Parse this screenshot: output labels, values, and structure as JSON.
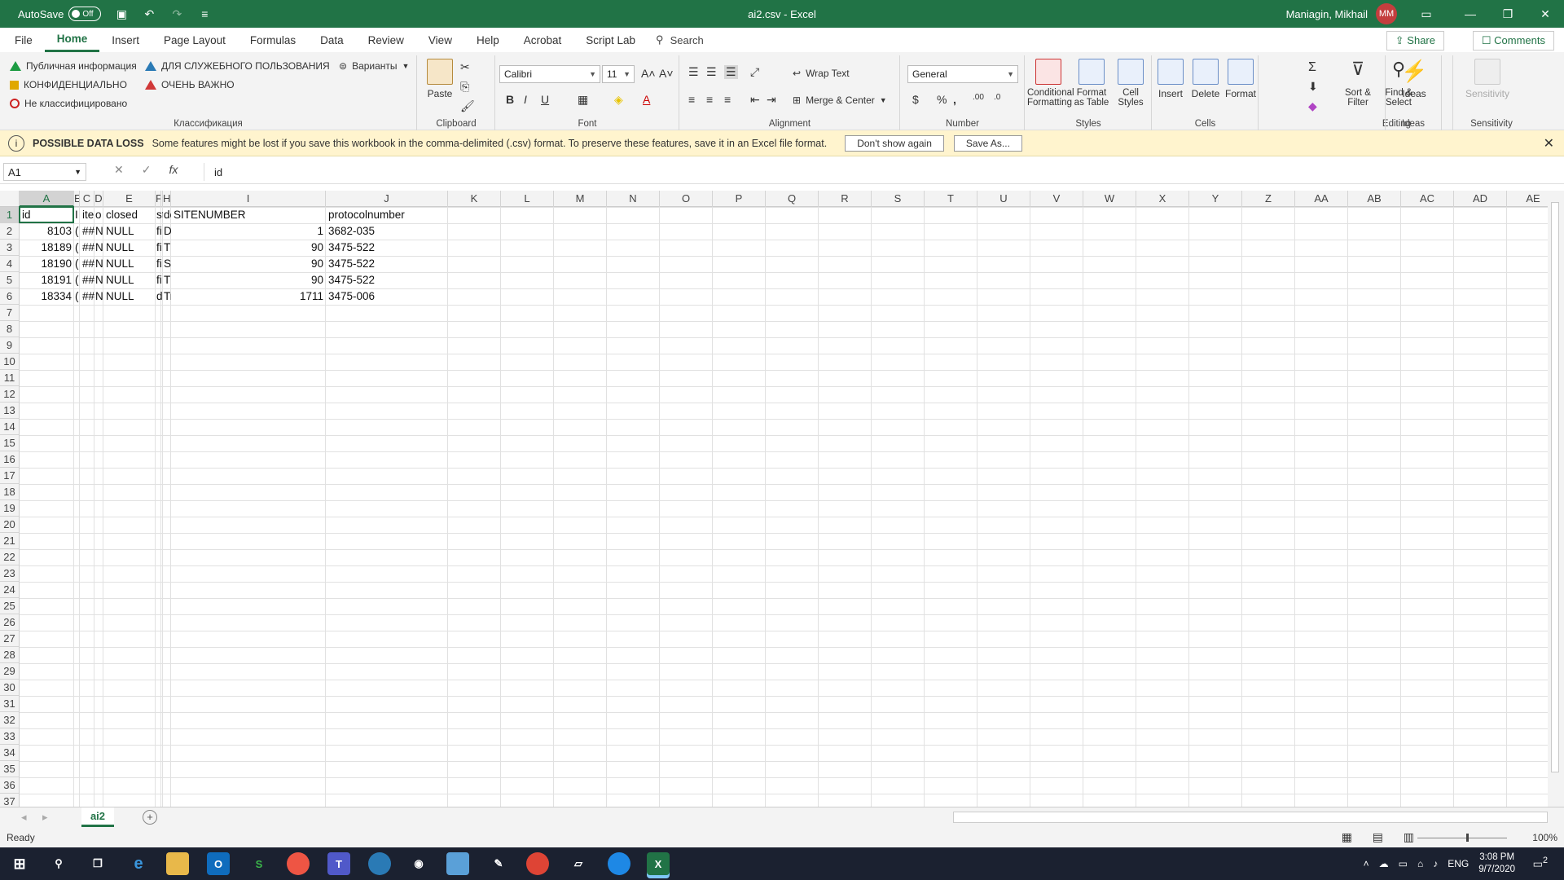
{
  "titlebar": {
    "autosave_label": "AutoSave",
    "autosave_state": "Off",
    "window_title": "ai2.csv  -  Excel",
    "user_name": "Maniagin, Mikhail",
    "user_initials": "MM"
  },
  "tabs": [
    "File",
    "Home",
    "Insert",
    "Page Layout",
    "Formulas",
    "Data",
    "Review",
    "View",
    "Help",
    "Acrobat",
    "Script Lab"
  ],
  "active_tab": "Home",
  "search_label": "Search",
  "share_label": "Share",
  "comments_label": "Comments",
  "ribbon": {
    "classification": {
      "items": [
        "Публичная информация",
        "КОНФИДЕНЦИАЛЬНО",
        "Не классифицировано",
        "ДЛЯ СЛУЖЕБНОГО ПОЛЬЗОВАНИЯ",
        "ОЧЕНЬ ВАЖНО"
      ],
      "variants_label": "Варианты",
      "group_label": "Классификация"
    },
    "clipboard": {
      "paste_label": "Paste",
      "group_label": "Clipboard"
    },
    "font": {
      "font_name": "Calibri",
      "font_size": "11",
      "group_label": "Font"
    },
    "alignment": {
      "wrap_text": "Wrap Text",
      "merge_center": "Merge & Center",
      "group_label": "Alignment"
    },
    "number": {
      "format": "General",
      "group_label": "Number"
    },
    "styles": {
      "conditional": "Conditional Formatting",
      "format_table": "Format as Table",
      "cell_styles": "Cell Styles",
      "group_label": "Styles"
    },
    "cells": {
      "insert": "Insert",
      "delete": "Delete",
      "format": "Format",
      "group_label": "Cells"
    },
    "editing": {
      "sort_filter": "Sort & Filter",
      "find_select": "Find & Select",
      "group_label": "Editing"
    },
    "ideas": {
      "ideas": "Ideas",
      "group_label": "Ideas"
    },
    "sensitivity": {
      "label": "Sensitivity",
      "group_label": "Sensitivity"
    }
  },
  "message_bar": {
    "title": "POSSIBLE DATA LOSS",
    "text": "Some features might be lost if you save this workbook in the comma-delimited (.csv) format. To preserve these features, save it in an Excel file format.",
    "button1": "Don't show again",
    "button2": "Save As..."
  },
  "formula_bar": {
    "name_box": "A1",
    "formula": "id"
  },
  "sheet": {
    "columns": [
      "A",
      "B",
      "C",
      "D",
      "E",
      "F",
      "G",
      "H",
      "I",
      "J",
      "K",
      "L",
      "M",
      "N",
      "O",
      "P",
      "Q",
      "R",
      "S",
      "T",
      "U",
      "V",
      "W",
      "X",
      "Y",
      "Z",
      "AA",
      "AB",
      "AC",
      "AD",
      "AE"
    ],
    "header_labels": [
      "A",
      "E",
      "C",
      "D",
      "E",
      "F",
      "",
      "H",
      "I",
      "J",
      "K",
      "L",
      "M",
      "N",
      "O",
      "P",
      "Q",
      "R",
      "S",
      "T",
      "U",
      "V",
      "W",
      "X",
      "Y",
      "Z",
      "AA",
      "AB",
      "AC",
      "AD",
      "AE"
    ],
    "row_numbers": [
      "1",
      "2",
      "3",
      "4",
      "5",
      "6",
      "7",
      "8",
      "9",
      "10",
      "11",
      "12",
      "13",
      "14",
      "15",
      "16",
      "17",
      "18",
      "19",
      "20",
      "21",
      "22",
      "23",
      "24",
      "25",
      "26",
      "27",
      "28",
      "29",
      "30",
      "31",
      "32",
      "33",
      "34",
      "35",
      "36",
      "37"
    ],
    "rows": [
      [
        "id",
        "I",
        "item",
        "o",
        "closed",
        "st",
        "de",
        "SITENUMBER",
        "protocolnumber"
      ],
      [
        "8103",
        "(",
        "###",
        "N",
        "NULL",
        "fi",
        "Dr",
        "1",
        "3682-035"
      ],
      [
        "18189",
        "(",
        "###",
        "N",
        "NULL",
        "fi",
        "Th",
        "90",
        "3475-522"
      ],
      [
        "18190",
        "(",
        "###",
        "N",
        "NULL",
        "fi",
        "St",
        "90",
        "3475-522"
      ],
      [
        "18191",
        "(",
        "###",
        "N",
        "NULL",
        "fi",
        "Th",
        "90",
        "3475-522"
      ],
      [
        "18334",
        "(",
        "###",
        "N",
        "NULL",
        "d",
        "Tr",
        "1711",
        "3475-006"
      ]
    ]
  },
  "sheet_tab": "ai2",
  "status": {
    "ready": "Ready",
    "zoom": "100%"
  },
  "taskbar": {
    "lang": "ENG",
    "time": "3:08 PM",
    "date": "9/7/2020",
    "notifications": "2"
  }
}
